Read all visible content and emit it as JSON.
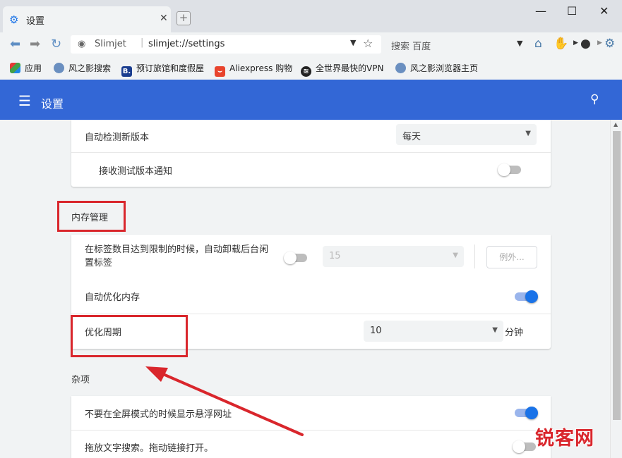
{
  "tab": {
    "title": "设置"
  },
  "window": {
    "minimize": "—",
    "maximize": "☐",
    "close": "✕"
  },
  "toolbar": {
    "site_name": "Slimjet",
    "url": "slimjet://settings",
    "search_placeholder": "搜索 百度"
  },
  "bookmarks": [
    {
      "label": "应用",
      "icon": "apps-grid-icon"
    },
    {
      "label": "风之影搜索",
      "icon": "globe-icon"
    },
    {
      "label": "预订旅馆和度假屋",
      "icon": "booking-b-icon"
    },
    {
      "label": "Aliexpress 购物",
      "icon": "aliexpress-icon"
    },
    {
      "label": "全世界最快的VPN",
      "icon": "vpn-icon"
    },
    {
      "label": "风之影浏览器主页",
      "icon": "globe-icon"
    }
  ],
  "header": {
    "title": "设置"
  },
  "update_card": {
    "check_label": "自动检测新版本",
    "check_value": "每天",
    "beta_label": "接收测试版本通知",
    "beta_on": false
  },
  "memory": {
    "heading": "内存管理",
    "unload_label_line1": "在标签数目达到限制的时候，自动卸载后台闲",
    "unload_label_line2": "置标签",
    "unload_on": false,
    "unload_value": "15",
    "exceptions_label": "例外...",
    "optimize_label": "自动优化内存",
    "optimize_on": true,
    "period_label": "优化周期",
    "period_value": "10",
    "period_unit": "分钟"
  },
  "misc": {
    "heading": "杂项",
    "fullscreen_label": "不要在全屏模式的时候显示悬浮网址",
    "fullscreen_on": true,
    "dragdrop_label": "拖放文字搜索。拖动链接打开。",
    "dragdrop_on": false
  },
  "watermark": {
    "text": "锐客网"
  },
  "colors": {
    "accent": "#3367d6",
    "annotation": "#d9262c",
    "toggle_on": "#1a73e8"
  }
}
